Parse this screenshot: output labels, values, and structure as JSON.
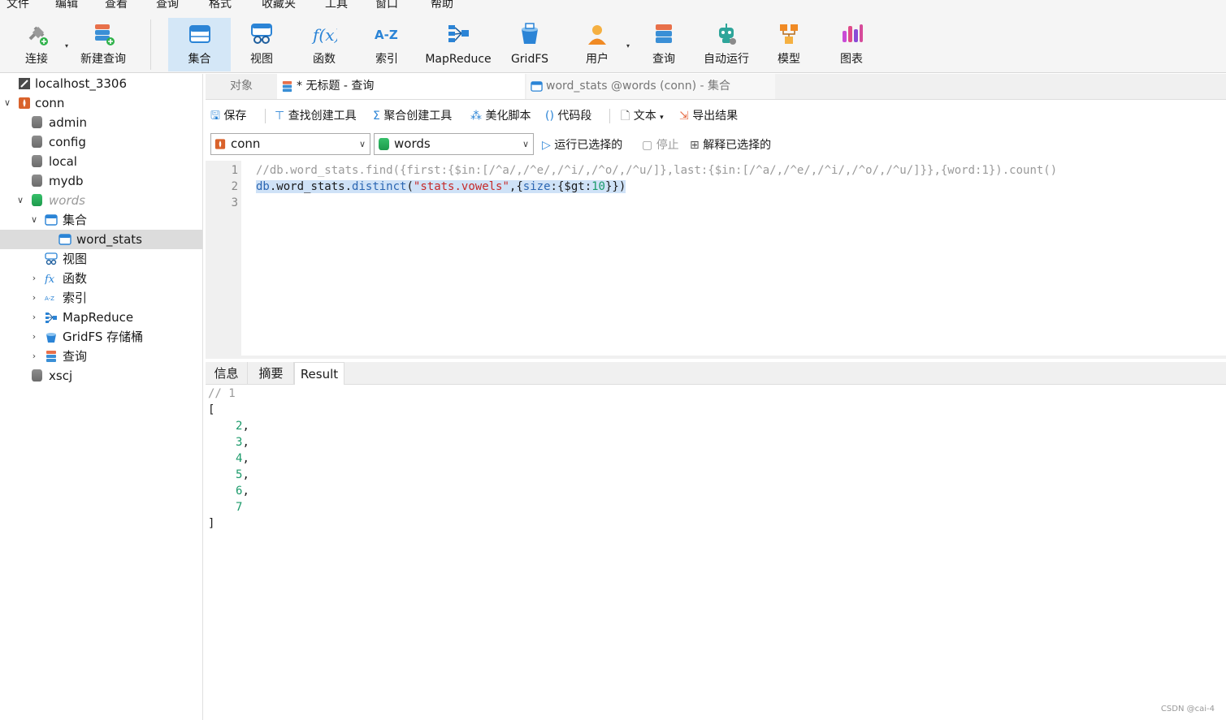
{
  "menu": [
    "文件",
    "编辑",
    "查看",
    "查询",
    "格式",
    "收藏夹",
    "工具",
    "窗口",
    "帮助"
  ],
  "toolbar": {
    "connect": "连接",
    "new_query": "新建查询",
    "collection": "集合",
    "view": "视图",
    "function": "函数",
    "index": "索引",
    "mapreduce": "MapReduce",
    "gridfs": "GridFS",
    "user": "用户",
    "query": "查询",
    "auto_run": "自动运行",
    "model": "模型",
    "chart": "图表",
    "index_icon_text": "A-Z",
    "function_icon_text": "f(x)"
  },
  "tree": {
    "server": "localhost_3306",
    "conn": "conn",
    "dbs": [
      "admin",
      "config",
      "local",
      "mydb"
    ],
    "words_db": "words",
    "collections_folder": "集合",
    "collection_item": "word_stats",
    "views": "视图",
    "functions": "函数",
    "indexes": "索引",
    "mapreduce": "MapReduce",
    "gridfs": "GridFS 存储桶",
    "queries": "查询",
    "last_db": "xscj",
    "index_icon_text": "A-Z",
    "function_icon_text": "fx"
  },
  "tabs": {
    "objects": "对象",
    "query_tab": "* 无标题 - 查询",
    "collection_tab": "word_stats @words (conn) - 集合"
  },
  "query_toolbar": {
    "save": "保存",
    "find_builder": "查找创建工具",
    "agg_builder": "聚合创建工具",
    "beautify": "美化脚本",
    "snippet": "代码段",
    "text": "文本",
    "export": "导出结果"
  },
  "selectors": {
    "connection": "conn",
    "database": "words",
    "run_selected": "运行已选择的",
    "stop": "停止",
    "explain_selected": "解释已选择的"
  },
  "editor": {
    "line_numbers": [
      "1",
      "2",
      "3"
    ],
    "line1": "//db.word_stats.find({first:{$in:[/^a/,/^e/,/^i/,/^o/,/^u/]},last:{$in:[/^a/,/^e/,/^i/,/^o/,/^u/]}},{word:1}).count()",
    "line2_parts": {
      "db": "db",
      "dot1": ".",
      "coll": "word_stats",
      "dot2": ".",
      "fn": "distinct",
      "open": "(",
      "str": "\"stats.vowels\"",
      "comma": ",",
      "brace_open": "{",
      "key": "size",
      "colon": ":",
      "inner_open": "{",
      "op": "$gt",
      "colon2": ":",
      "num": "10",
      "close": "}})"
    }
  },
  "result_tabs": [
    "信息",
    "摘要",
    "Result"
  ],
  "result": {
    "header": "// 1",
    "open": "[",
    "values": [
      "2",
      "3",
      "4",
      "5",
      "6",
      "7"
    ],
    "close": "]"
  },
  "watermark": "CSDN @cai-4"
}
